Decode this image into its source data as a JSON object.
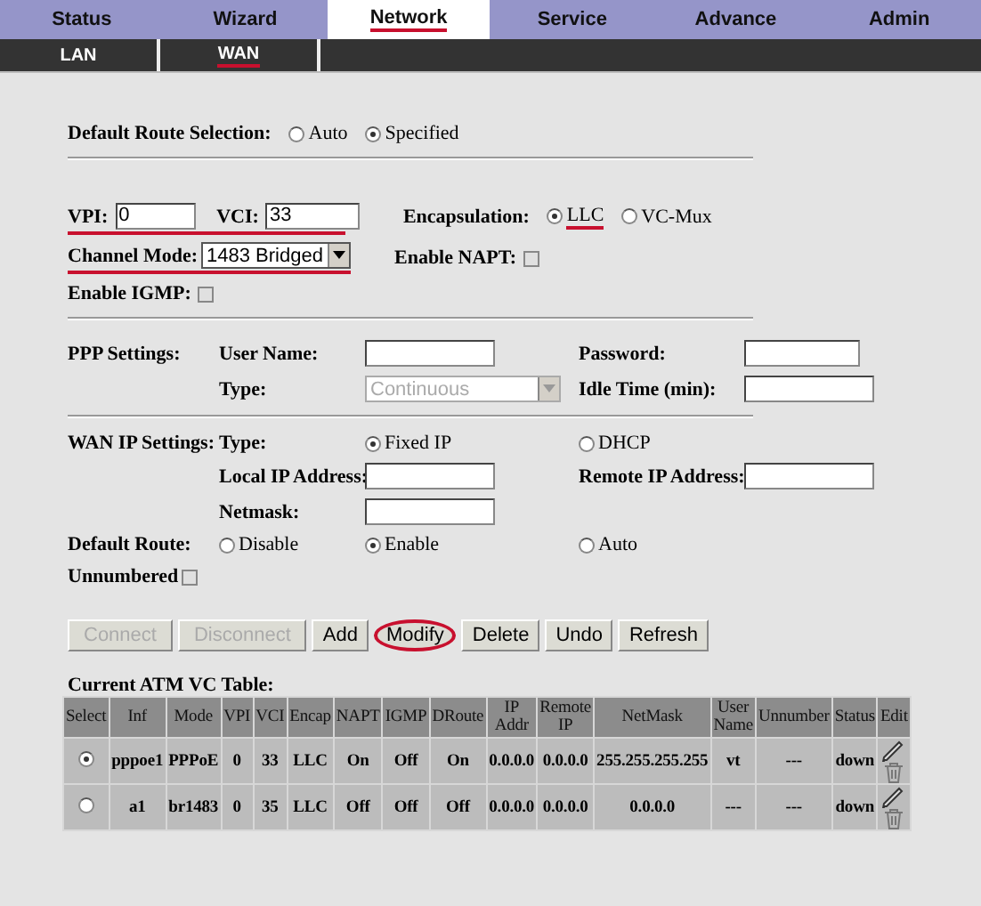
{
  "nav": [
    {
      "label": "Status",
      "selected": false,
      "marked": false
    },
    {
      "label": "Wizard",
      "selected": false,
      "marked": false
    },
    {
      "label": "Network",
      "selected": true,
      "marked": true
    },
    {
      "label": "Service",
      "selected": false,
      "marked": false
    },
    {
      "label": "Advance",
      "selected": false,
      "marked": false
    },
    {
      "label": "Admin",
      "selected": false,
      "marked": false
    }
  ],
  "subnav": [
    {
      "label": "LAN",
      "marked": false
    },
    {
      "label": "WAN",
      "marked": true
    }
  ],
  "default_route_selection": {
    "label": "Default Route Selection:",
    "options": [
      {
        "label": "Auto",
        "selected": false
      },
      {
        "label": "Specified",
        "selected": true
      }
    ]
  },
  "vpi": {
    "label": "VPI:",
    "value": "0"
  },
  "vci": {
    "label": "VCI:",
    "value": "33"
  },
  "vpi_vci_marked": true,
  "encapsulation": {
    "label": "Encapsulation:",
    "options": [
      {
        "label": "LLC",
        "selected": true,
        "marked": true
      },
      {
        "label": "VC-Mux",
        "selected": false,
        "marked": false
      }
    ]
  },
  "channel_mode": {
    "label": "Channel Mode:",
    "value": "1483 Bridged",
    "marked": true
  },
  "enable_napt": {
    "label": "Enable NAPT:",
    "checked": false
  },
  "enable_igmp": {
    "label": "Enable IGMP:",
    "checked": false
  },
  "ppp": {
    "label": "PPP Settings:",
    "user_name_label": "User Name:",
    "password_label": "Password:",
    "type_label": "Type:",
    "type_value": "Continuous",
    "idle_label": "Idle Time (min):"
  },
  "wan_ip": {
    "label": "WAN IP Settings:",
    "type_label": "Type:",
    "types": [
      {
        "label": "Fixed IP",
        "selected": true
      },
      {
        "label": "DHCP",
        "selected": false
      }
    ],
    "local_ip_label": "Local IP Address:",
    "remote_ip_label": "Remote IP Address:",
    "netmask_label": "Netmask:"
  },
  "default_route": {
    "label": "Default Route:",
    "options": [
      {
        "label": "Disable",
        "selected": false
      },
      {
        "label": "Enable",
        "selected": true
      },
      {
        "label": "Auto",
        "selected": false
      }
    ]
  },
  "unnumbered": {
    "label": "Unnumbered",
    "checked": false
  },
  "buttons": [
    {
      "label": "Connect",
      "disabled": true,
      "marked": false
    },
    {
      "label": "Disconnect",
      "disabled": true,
      "marked": false
    },
    {
      "label": "Add",
      "disabled": false,
      "marked": false
    },
    {
      "label": "Modify",
      "disabled": false,
      "marked": true
    },
    {
      "label": "Delete",
      "disabled": false,
      "marked": false
    },
    {
      "label": "Undo",
      "disabled": false,
      "marked": false
    },
    {
      "label": "Refresh",
      "disabled": false,
      "marked": false
    }
  ],
  "table": {
    "title": "Current ATM VC Table:",
    "columns": [
      "Select",
      "Inf",
      "Mode",
      "VPI",
      "VCI",
      "Encap",
      "NAPT",
      "IGMP",
      "DRoute",
      "IP Addr",
      "Remote IP",
      "NetMask",
      "User Name",
      "Unnumber",
      "Status",
      "Edit"
    ],
    "rows": [
      {
        "selected": true,
        "cells": [
          "",
          "pppoe1",
          "PPPoE",
          "0",
          "33",
          "LLC",
          "On",
          "Off",
          "On",
          "0.0.0.0",
          "0.0.0.0",
          "255.255.255.255",
          "vt",
          "---",
          "down",
          ""
        ]
      },
      {
        "selected": false,
        "cells": [
          "",
          "a1",
          "br1483",
          "0",
          "35",
          "LLC",
          "Off",
          "Off",
          "Off",
          "0.0.0.0",
          "0.0.0.0",
          "0.0.0.0",
          "---",
          "---",
          "down",
          ""
        ]
      }
    ]
  }
}
